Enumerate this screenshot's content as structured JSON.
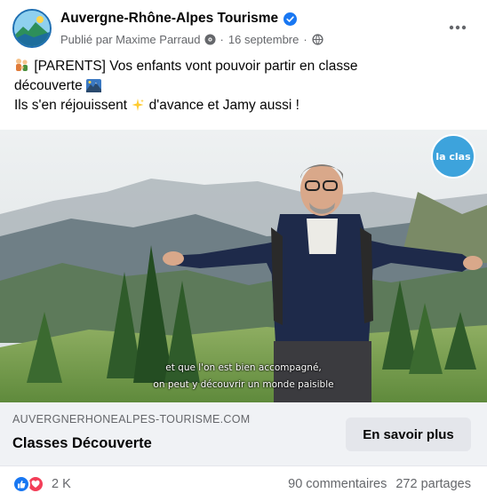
{
  "post": {
    "page_name": "Auvergne-Rhône-Alpes Tourisme",
    "published_by": "Publié par Maxime Parraud",
    "date": "16 septembre",
    "text_line1_prefix": "[PARENTS] Vos enfants vont pouvoir partir en classe",
    "text_line2": "découverte",
    "text_line3_a": "Ils s'en réjouissent",
    "text_line3_b": "d'avance et Jamy aussi !"
  },
  "video": {
    "caption_line1": "et que l'on est bien accompagné,",
    "caption_line2": "on peut y découvrir un monde paisible",
    "logo_text": "la clas"
  },
  "link": {
    "domain": "AUVERGNERHONEALPES-TOURISME.COM",
    "title": "Classes Découverte",
    "cta_label": "En savoir plus"
  },
  "engagement": {
    "reactions_count": "2 K",
    "comments": "90 commentaires",
    "shares": "272 partages"
  },
  "colors": {
    "verified_blue": "#1877f2",
    "like_blue": "#1877f2",
    "love_red": "#f33e58",
    "secondary_text": "#65676b"
  },
  "icons": [
    "verified-badge-icon",
    "gear-icon",
    "globe-icon",
    "more-options-icon",
    "family-emoji-icon",
    "mountain-landscape-emoji-icon",
    "sparkles-emoji-icon",
    "like-reaction-icon",
    "love-reaction-icon"
  ]
}
